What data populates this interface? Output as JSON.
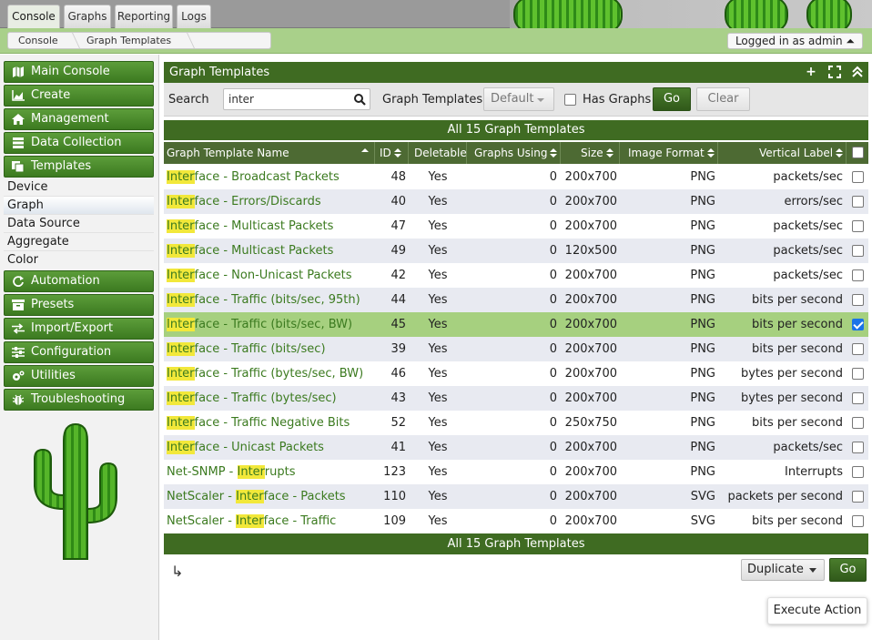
{
  "top_tabs": [
    {
      "label": "Console",
      "active": true
    },
    {
      "label": "Graphs",
      "active": false
    },
    {
      "label": "Reporting",
      "active": false
    },
    {
      "label": "Logs",
      "active": false
    }
  ],
  "breadcrumb": [
    "Console",
    "Graph Templates"
  ],
  "login_text": "Logged in as admin ⏶",
  "sidebar": {
    "menus_top": [
      {
        "label": "Main Console",
        "icon": "map-icon"
      },
      {
        "label": "Create",
        "icon": "chart-icon"
      },
      {
        "label": "Management",
        "icon": "home-icon"
      },
      {
        "label": "Data Collection",
        "icon": "database-icon"
      },
      {
        "label": "Templates",
        "icon": "copy-icon"
      }
    ],
    "submenu": [
      {
        "label": "Device",
        "active": false
      },
      {
        "label": "Graph",
        "active": true
      },
      {
        "label": "Data Source",
        "active": false
      },
      {
        "label": "Aggregate",
        "active": false
      },
      {
        "label": "Color",
        "active": false
      }
    ],
    "menus_bottom": [
      {
        "label": "Automation",
        "icon": "refresh-icon"
      },
      {
        "label": "Presets",
        "icon": "archive-icon"
      },
      {
        "label": "Import/Export",
        "icon": "exchange-icon"
      },
      {
        "label": "Configuration",
        "icon": "sliders-icon"
      },
      {
        "label": "Utilities",
        "icon": "cogs-icon"
      },
      {
        "label": "Troubleshooting",
        "icon": "bug-icon"
      }
    ]
  },
  "panel": {
    "title": "Graph Templates",
    "header_icons": [
      "plus-icon",
      "fullscreen-icon",
      "collapse-icon"
    ]
  },
  "filter": {
    "search_label": "Search",
    "search_value": "inter",
    "templates_label": "Graph Templates",
    "templates_value": "Default",
    "has_graphs_label": "Has Graphs",
    "has_graphs_checked": false,
    "go_label": "Go",
    "clear_label": "Clear"
  },
  "table": {
    "title": "All 15 Graph Templates",
    "footer": "All 15 Graph Templates",
    "columns": [
      "Graph Template Name",
      "ID",
      "Deletable",
      "Graphs Using",
      "Size",
      "Image Format",
      "Vertical Label"
    ],
    "rows": [
      {
        "pre": "",
        "hl": "Inter",
        "post": "face - Broadcast Packets",
        "id": "48",
        "deletable": "Yes",
        "graphs": "0",
        "size": "200x700",
        "format": "PNG",
        "vlabel": "packets/sec",
        "checked": false
      },
      {
        "pre": "",
        "hl": "Inter",
        "post": "face - Errors/Discards",
        "id": "40",
        "deletable": "Yes",
        "graphs": "0",
        "size": "200x700",
        "format": "PNG",
        "vlabel": "errors/sec",
        "checked": false
      },
      {
        "pre": "",
        "hl": "Inter",
        "post": "face - Multicast Packets",
        "id": "47",
        "deletable": "Yes",
        "graphs": "0",
        "size": "200x700",
        "format": "PNG",
        "vlabel": "packets/sec",
        "checked": false
      },
      {
        "pre": "",
        "hl": "Inter",
        "post": "face - Multicast Packets",
        "id": "49",
        "deletable": "Yes",
        "graphs": "0",
        "size": "120x500",
        "format": "PNG",
        "vlabel": "packets/sec",
        "checked": false
      },
      {
        "pre": "",
        "hl": "Inter",
        "post": "face - Non-Unicast Packets",
        "id": "42",
        "deletable": "Yes",
        "graphs": "0",
        "size": "200x700",
        "format": "PNG",
        "vlabel": "packets/sec",
        "checked": false
      },
      {
        "pre": "",
        "hl": "Inter",
        "post": "face - Traffic (bits/sec, 95th)",
        "id": "44",
        "deletable": "Yes",
        "graphs": "0",
        "size": "200x700",
        "format": "PNG",
        "vlabel": "bits per second",
        "checked": false
      },
      {
        "pre": "",
        "hl": "Inter",
        "post": "face - Traffic (bits/sec, BW)",
        "id": "45",
        "deletable": "Yes",
        "graphs": "0",
        "size": "200x700",
        "format": "PNG",
        "vlabel": "bits per second",
        "checked": true
      },
      {
        "pre": "",
        "hl": "Inter",
        "post": "face - Traffic (bits/sec)",
        "id": "39",
        "deletable": "Yes",
        "graphs": "0",
        "size": "200x700",
        "format": "PNG",
        "vlabel": "bits per second",
        "checked": false
      },
      {
        "pre": "",
        "hl": "Inter",
        "post": "face - Traffic (bytes/sec, BW)",
        "id": "46",
        "deletable": "Yes",
        "graphs": "0",
        "size": "200x700",
        "format": "PNG",
        "vlabel": "bytes per second",
        "checked": false
      },
      {
        "pre": "",
        "hl": "Inter",
        "post": "face - Traffic (bytes/sec)",
        "id": "43",
        "deletable": "Yes",
        "graphs": "0",
        "size": "200x700",
        "format": "PNG",
        "vlabel": "bytes per second",
        "checked": false
      },
      {
        "pre": "",
        "hl": "Inter",
        "post": "face - Traffic Negative Bits",
        "id": "52",
        "deletable": "Yes",
        "graphs": "0",
        "size": "250x750",
        "format": "PNG",
        "vlabel": "bits per second",
        "checked": false
      },
      {
        "pre": "",
        "hl": "Inter",
        "post": "face - Unicast Packets",
        "id": "41",
        "deletable": "Yes",
        "graphs": "0",
        "size": "200x700",
        "format": "PNG",
        "vlabel": "packets/sec",
        "checked": false
      },
      {
        "pre": "Net-SNMP - ",
        "hl": "Inter",
        "post": "rupts",
        "id": "123",
        "deletable": "Yes",
        "graphs": "0",
        "size": "200x700",
        "format": "PNG",
        "vlabel": "Interrupts",
        "checked": false
      },
      {
        "pre": "NetScaler - ",
        "hl": "Inter",
        "post": "face - Packets",
        "id": "110",
        "deletable": "Yes",
        "graphs": "0",
        "size": "200x700",
        "format": "SVG",
        "vlabel": "packets per second",
        "checked": false
      },
      {
        "pre": "NetScaler - ",
        "hl": "Inter",
        "post": "face - Traffic",
        "id": "109",
        "deletable": "Yes",
        "graphs": "0",
        "size": "200x700",
        "format": "SVG",
        "vlabel": "bits per second",
        "checked": false
      }
    ]
  },
  "actions": {
    "selected": "Duplicate",
    "go_label": "Go",
    "execute_label": "Execute Action"
  },
  "colors": {
    "header_green": "#3f6b22",
    "link_green": "#3b7a1f",
    "highlight": "#f2e83a",
    "selected_row": "#a6d07f"
  }
}
